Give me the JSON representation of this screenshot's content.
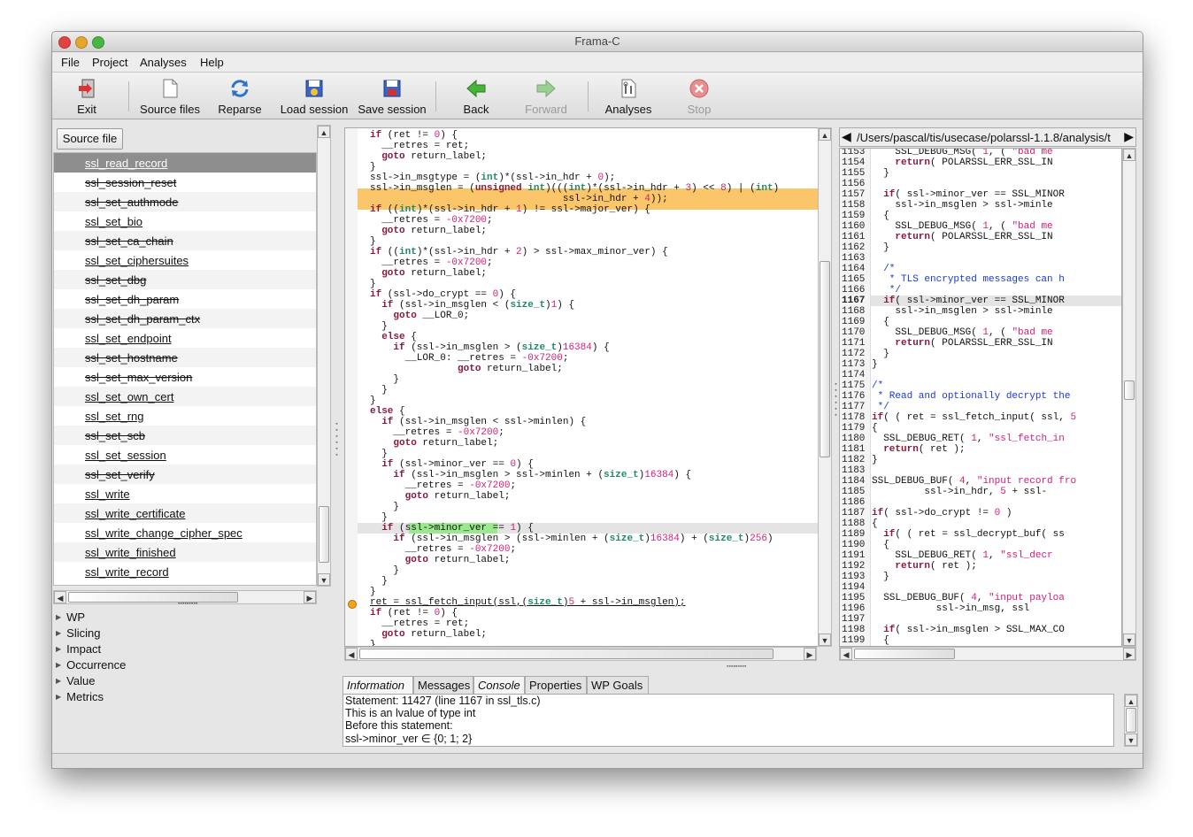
{
  "window": {
    "title": "Frama-C"
  },
  "menu": [
    "File",
    "Project",
    "Analyses",
    "Help"
  ],
  "toolbar": {
    "exit": "Exit",
    "source_files": "Source files",
    "reparse": "Reparse",
    "load_session": "Load session",
    "save_session": "Save session",
    "back": "Back",
    "forward": "Forward",
    "analyses": "Analyses",
    "stop": "Stop"
  },
  "sidebar": {
    "source_file_button": "Source file",
    "functions": [
      "ssl_read_record",
      "ssl_session_reset",
      "ssl_set_authmode",
      "ssl_set_bio",
      "ssl_set_ca_chain",
      "ssl_set_ciphersuites",
      "ssl_set_dbg",
      "ssl_set_dh_param",
      "ssl_set_dh_param_ctx",
      "ssl_set_endpoint",
      "ssl_set_hostname",
      "ssl_set_max_version",
      "ssl_set_own_cert",
      "ssl_set_rng",
      "ssl_set_scb",
      "ssl_set_session",
      "ssl_set_verify",
      "ssl_write",
      "ssl_write_certificate",
      "ssl_write_change_cipher_spec",
      "ssl_write_finished",
      "ssl_write_record"
    ],
    "plugins": [
      "WP",
      "Slicing",
      "Impact",
      "Occurrence",
      "Value",
      "Metrics"
    ]
  },
  "right_pane": {
    "path": "/Users/pascal/tis/usecase/polarssl-1.1.8/analysis/t"
  },
  "bottom": {
    "tabs": [
      "Information",
      "Messages",
      "Console",
      "Properties",
      "WP Goals"
    ],
    "info_lines": [
      "Statement: 11427 (line 1167 in ssl_tls.c)",
      "This is an lvalue of type int",
      "Before this statement:",
      " ssl->minor_ver ∈ {0; 1; 2}"
    ]
  },
  "colors": {
    "keyword": "#8b1a3a",
    "type": "#1f8a6a",
    "number": "#d0207a",
    "comment": "#1a3ad0",
    "highlight_orange": "#fbc66a",
    "highlight_green": "#9be88e",
    "current_line": "#e4e4e4"
  }
}
